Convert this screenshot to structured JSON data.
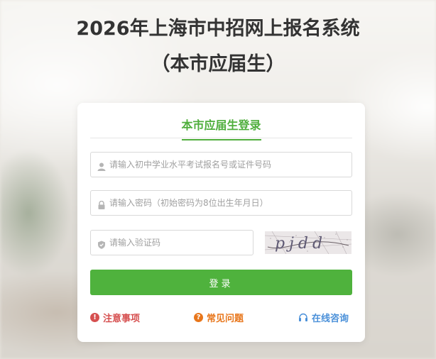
{
  "header": {
    "title_line1": "2026年上海市中招网上报名系统",
    "title_line2": "（本市应届生）"
  },
  "login": {
    "tab_label": "本市应届生登录",
    "id_placeholder": "请输入初中学业水平考试报名号或证件号码",
    "password_placeholder": "请输入密码（初始密码为8位出生年月日）",
    "captcha_placeholder": "请输入验证码",
    "captcha_text": "pjdd",
    "submit_label": "登录"
  },
  "links": {
    "notice": "注意事项",
    "faq": "常见问题",
    "consult": "在线咨询"
  },
  "colors": {
    "accent_green": "#4fb23d",
    "notice_red": "#d65050",
    "faq_orange": "#e8761b",
    "consult_blue": "#4a90d9"
  },
  "icons": {
    "id_field": "user-icon",
    "password_field": "lock-icon",
    "captcha_field": "shield-icon",
    "notice": "exclamation-circle-icon",
    "faq": "question-circle-icon",
    "consult": "headset-icon"
  }
}
